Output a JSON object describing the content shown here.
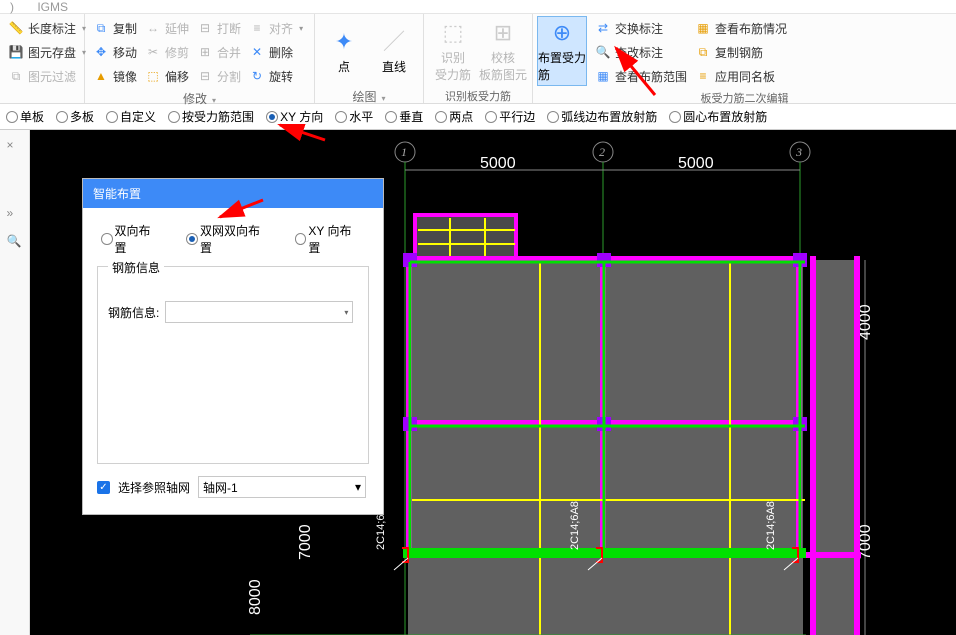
{
  "top_tabs": {
    "left": ")",
    "right": "IGMS"
  },
  "ribbon": {
    "group1": {
      "a": "长度标注",
      "b": "图元存盘",
      "c": "图元过滤"
    },
    "group_modify": {
      "label": "修改",
      "items": {
        "copy": "复制",
        "stretch": "延伸",
        "break": "打断",
        "align": "对齐",
        "move": "移动",
        "trim": "修剪",
        "merge": "合并",
        "delete": "删除",
        "mirror": "镜像",
        "offset": "偏移",
        "split": "分割",
        "rotate": "旋转"
      }
    },
    "group_draw": {
      "label": "绘图",
      "items": {
        "point": "点",
        "line": "直线"
      }
    },
    "group_recognize": {
      "label": "识别板受力筋",
      "items": {
        "recognize": "识别\n受力筋",
        "check": "校核\n板筋图元"
      }
    },
    "group_place": {
      "label": "板受力筋二次编辑",
      "big": "布置受力筋",
      "items": {
        "swap": "交换标注",
        "detail": "查看布筋情况",
        "find": "查改标注",
        "copy": "复制钢筋",
        "range": "查看布筋范围",
        "apply": "应用同名板"
      }
    }
  },
  "option_bar": {
    "opts": [
      "单板",
      "多板",
      "自定义",
      "按受力筋范围",
      "XY 方向",
      "水平",
      "垂直",
      "两点",
      "平行边",
      "弧线边布置放射筋",
      "圆心布置放射筋"
    ],
    "selected": "XY 方向"
  },
  "dlg": {
    "title": "智能布置",
    "radios": {
      "a": "双向布置",
      "b": "双网双向布置",
      "c": "XY 向布置"
    },
    "radio_selected": "双网双向布置",
    "fieldset_legend": "钢筋信息",
    "field_label": "钢筋信息:",
    "foot_check": "选择参照轴网",
    "foot_select": "轴网-1"
  },
  "axes": {
    "n1": "1",
    "n2": "2",
    "n3": "3"
  },
  "dims": {
    "h1": "5000",
    "h2": "5000",
    "v1": "4000",
    "v2": "7000",
    "v_left1": "7000",
    "v_left2": "8000"
  },
  "bars": {
    "label": "2C14;6A8"
  }
}
